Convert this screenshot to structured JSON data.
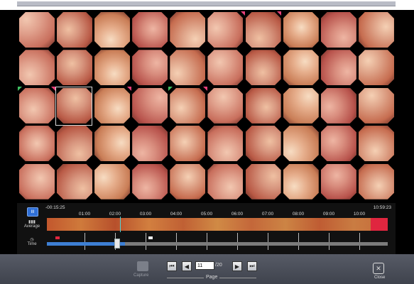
{
  "timeline": {
    "start_time": "-00:15:25",
    "end_time": "10:59:23",
    "ticks": [
      "01:00",
      "02:00",
      "03:00",
      "04:00",
      "05:00",
      "06:00",
      "07:00",
      "08:00",
      "09:00",
      "10:00"
    ],
    "view_button": "III",
    "average_label": "Average",
    "time_label": "Time"
  },
  "toolbar": {
    "capture_label": "Capture",
    "current_page": "11",
    "total_pages": "/20",
    "page_label": "Page",
    "close_label": "Close"
  },
  "colors": {
    "tissue_base": "#d98f80",
    "marker_red": "#e8407a",
    "marker_green": "#3fbf62",
    "timeline_blue": "#3d7fd4",
    "bleeding_red": "#e0263f"
  },
  "icons": [
    "first-page-icon",
    "prev-page-icon",
    "next-page-icon",
    "last-page-icon",
    "close-icon",
    "camera-icon",
    "clock-icon",
    "bars-icon"
  ]
}
